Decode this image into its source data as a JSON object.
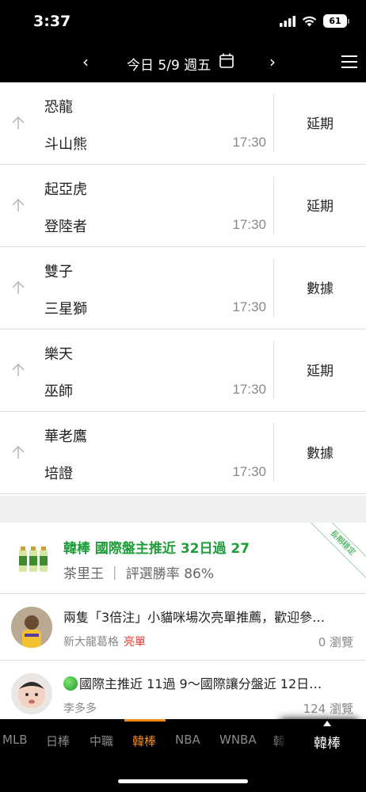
{
  "status_bar": {
    "time": "3:37",
    "battery": "61"
  },
  "nav": {
    "prev": "‹",
    "next": "›",
    "title": "今日 5/9 週五",
    "calendar_icon": "calendar-icon",
    "menu_icon": "menu-icon"
  },
  "games": [
    {
      "home": "恐龍",
      "away": "斗山熊",
      "time": "17:30",
      "status": "延期"
    },
    {
      "home": "起亞虎",
      "away": "登陸者",
      "time": "17:30",
      "status": "延期"
    },
    {
      "home": "雙子",
      "away": "三星獅",
      "time": "17:30",
      "status": "數據"
    },
    {
      "home": "樂天",
      "away": "巫師",
      "time": "17:30",
      "status": "延期"
    },
    {
      "home": "華老鷹",
      "away": "培證",
      "time": "17:30",
      "status": "數據"
    }
  ],
  "promo": {
    "title": "韓棒 國際盤主推近 32日過 27",
    "subtitle": "茶里王 ｜ 評選勝率 86%",
    "ribbon": "長期穩定"
  },
  "posts": [
    {
      "title": "兩隻「3倍注」小貓咪場次亮單推薦，歡迎參…",
      "author": "新大龍葛格",
      "tag": "亮單",
      "views": "0 瀏覽"
    },
    {
      "title": "國際主推近 11過 9～國際讓分盤近 12日…",
      "author": "李多多",
      "tag": "",
      "views": "124 瀏覽"
    }
  ],
  "tabs": [
    "MLB",
    "日棒",
    "中職",
    "韓棒",
    "NBA",
    "WNBA",
    "韓"
  ],
  "active_tab": "韓棒",
  "more_tab": {
    "label": "韓棒"
  },
  "colors": {
    "accent": "#f28a1e",
    "promo_green": "#1e9e3a",
    "tag_red": "#e23c2f"
  }
}
